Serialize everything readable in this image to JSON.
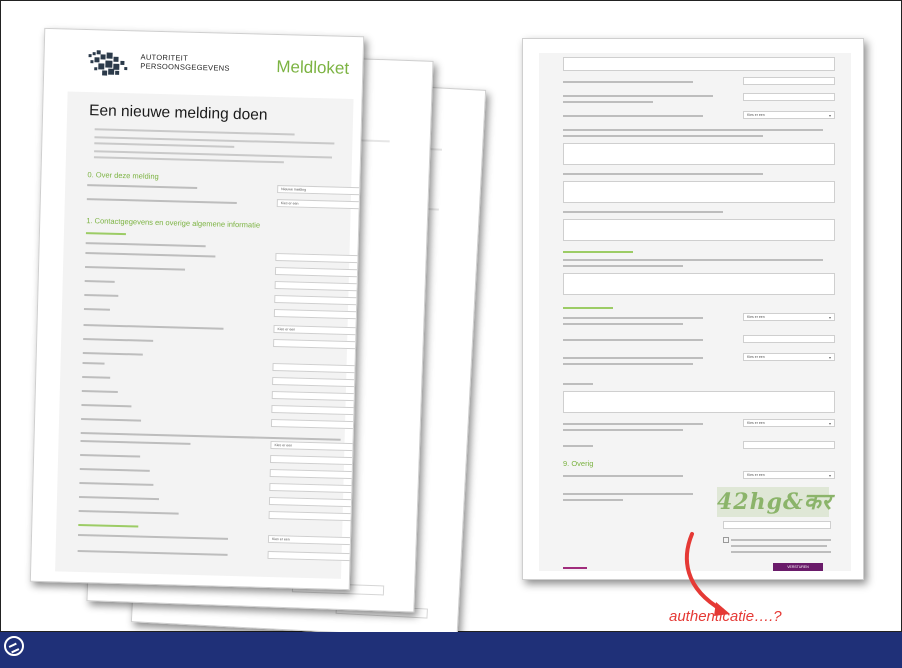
{
  "form": {
    "org_line1": "AUTORITEIT",
    "org_line2": "PERSOONSGEGEVENS",
    "app_title": "Meldloket",
    "page_title": "Een nieuwe melding doen",
    "section1": "0. Over deze melding",
    "section2": "1. Contactgegevens en overige algemene informatie",
    "default_field_value": "Nieuwe melding",
    "select_placeholder": "Kies er een",
    "section_overig": "9. Overig"
  },
  "captcha": {
    "text": "42hg&कर"
  },
  "right_form": {
    "submit_label": "VERSTUREN"
  },
  "annotation": {
    "text": "authenticatie….?",
    "color": "#e53935"
  },
  "colors": {
    "accent_green": "#7cb342",
    "bottom_bar": "#1f3078",
    "submit_purple": "#6a1b6a"
  }
}
